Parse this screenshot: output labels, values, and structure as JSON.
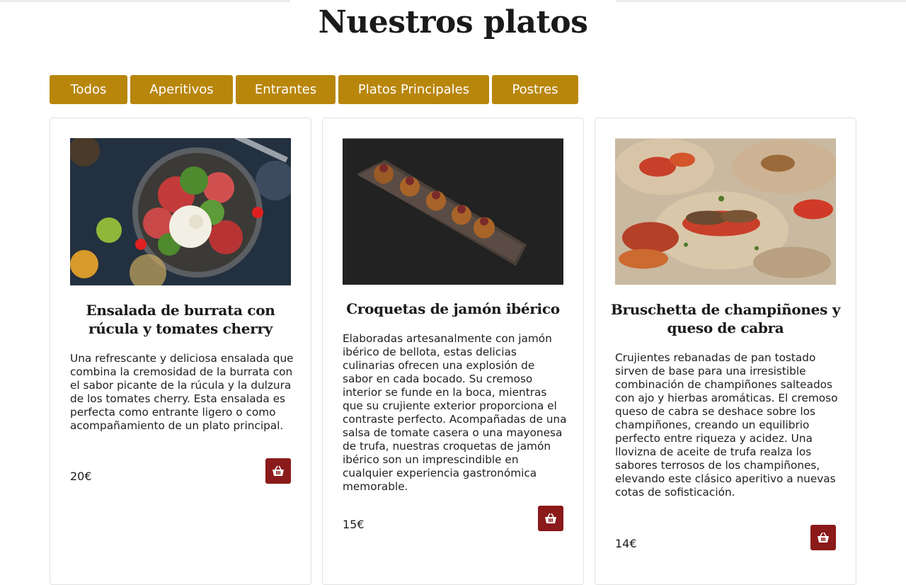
{
  "colors": {
    "accent": "#b8860b",
    "cart_button": "#8b1a1a"
  },
  "page": {
    "title": "Nuestros platos"
  },
  "filters": [
    {
      "label": "Todos"
    },
    {
      "label": "Aperitivos"
    },
    {
      "label": "Entrantes"
    },
    {
      "label": "Platos Principales"
    },
    {
      "label": "Postres"
    }
  ],
  "dishes": [
    {
      "name": "Ensalada de burrata con rúcula y tomates cherry",
      "description": "Una refrescante y deliciosa ensalada que combina la cremosidad de la burrata con el sabor picante de la rúcula y la dulzura de los tomates cherry. Esta ensalada es perfecta como entrante ligero o como acompañamiento de un plato principal.",
      "price": "20€",
      "image_icon": "salad-photo",
      "cart_icon": "basket-icon"
    },
    {
      "name": "Croquetas de jamón ibérico",
      "description": "Elaboradas artesanalmente con jamón ibérico de bellota, estas delicias culinarias ofrecen una explosión de sabor en cada bocado. Su cremoso interior se funde en la boca, mientras que su crujiente exterior proporciona el contraste perfecto. Acompañadas de una salsa de tomate casera o una mayonesa de trufa, nuestras croquetas de jamón ibérico son un imprescindible en cualquier experiencia gastronómica memorable.",
      "price": "15€",
      "image_icon": "croquettes-photo",
      "cart_icon": "basket-icon"
    },
    {
      "name": "Bruschetta de champiñones y queso de cabra",
      "description": "Crujientes rebanadas de pan tostado sirven de base para una irresistible combinación de champiñones salteados con ajo y hierbas aromáticas. El cremoso queso de cabra se deshace sobre los champiñones, creando un equilibrio perfecto entre riqueza y acidez. Una llovizna de aceite de trufa realza los sabores terrosos de los champiñones, elevando este clásico aperitivo a nuevas cotas de sofisticación.",
      "price": "14€",
      "image_icon": "bruschetta-photo",
      "cart_icon": "basket-icon"
    }
  ]
}
